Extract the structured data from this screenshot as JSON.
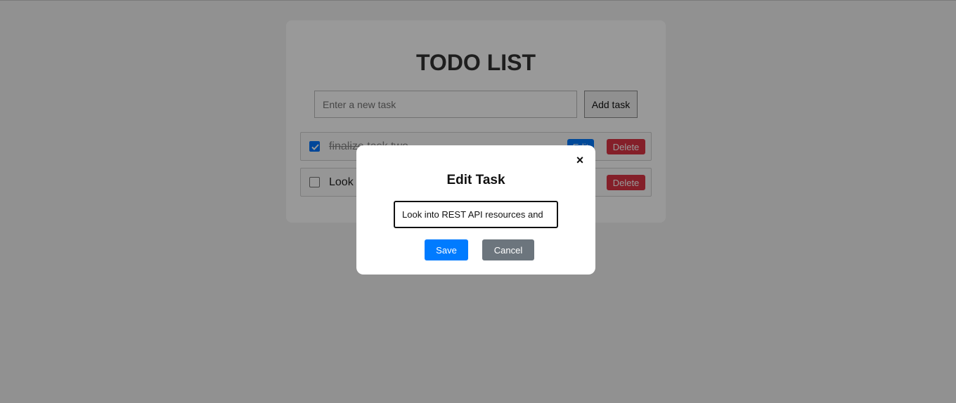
{
  "app": {
    "title": "TODO LIST",
    "new_task": {
      "placeholder": "Enter a new task",
      "value": ""
    },
    "add_button_label": "Add task"
  },
  "tasks": [
    {
      "text": "finalize task two",
      "completed": true,
      "edit_label": "Edit",
      "delete_label": "Delete"
    },
    {
      "text": "Look",
      "completed": false,
      "delete_label": "Delete"
    }
  ],
  "modal": {
    "title": "Edit Task",
    "close_icon": "×",
    "input_value": "Look into REST API resources and",
    "save_label": "Save",
    "cancel_label": "Cancel"
  },
  "colors": {
    "primary": "#007bff",
    "danger": "#dc3545",
    "secondary": "#6c757d",
    "overlay": "rgba(0,0,0,0.4)"
  },
  "icons": {
    "checkbox_checked": "check-icon",
    "close": "close-icon"
  }
}
